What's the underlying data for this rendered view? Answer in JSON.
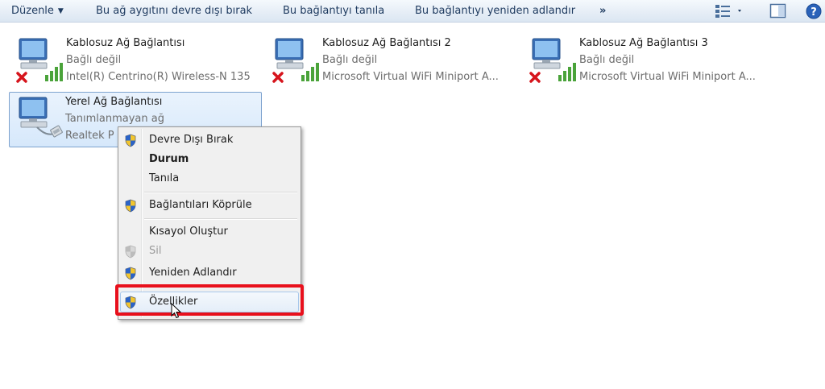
{
  "toolbar": {
    "organize": "Düzenle",
    "disable": "Bu ağ aygıtını devre dışı bırak",
    "diagnose": "Bu bağlantıyı tanıla",
    "rename": "Bu bağlantıyı yeniden adlandır",
    "more": "»"
  },
  "connections": [
    {
      "name": "Kablosuz Ağ Bağlantısı",
      "status": "Bağlı değil",
      "adapter": "Intel(R) Centrino(R) Wireless-N 135"
    },
    {
      "name": "Kablosuz Ağ Bağlantısı 2",
      "status": "Bağlı değil",
      "adapter": "Microsoft Virtual WiFi Miniport A..."
    },
    {
      "name": "Kablosuz Ağ Bağlantısı 3",
      "status": "Bağlı değil",
      "adapter": "Microsoft Virtual WiFi Miniport A..."
    },
    {
      "name": "Yerel Ağ Bağlantısı",
      "status": "Tanımlanmayan ağ",
      "adapter": "Realtek P"
    }
  ],
  "context_menu": {
    "items": [
      {
        "label": "Devre Dışı Bırak",
        "icon": "uac-shield-icon"
      },
      {
        "label": "Durum",
        "icon": ""
      },
      {
        "label": "Tanıla",
        "icon": ""
      },
      {
        "label": "Bağlantıları Köprüle",
        "icon": "uac-shield-icon"
      },
      {
        "label": "Kısayol Oluştur",
        "icon": ""
      },
      {
        "label": "Sil",
        "icon": "uac-shield-icon"
      },
      {
        "label": "Yeniden Adlandır",
        "icon": "uac-shield-icon"
      },
      {
        "label": "Özellikler",
        "icon": "uac-shield-icon"
      }
    ],
    "hovered": "Özellikler",
    "default_item": "Durum",
    "disabled_item": "Sil"
  },
  "colors": {
    "highlight": "#e8101c",
    "selection_border": "#7da2ce"
  }
}
